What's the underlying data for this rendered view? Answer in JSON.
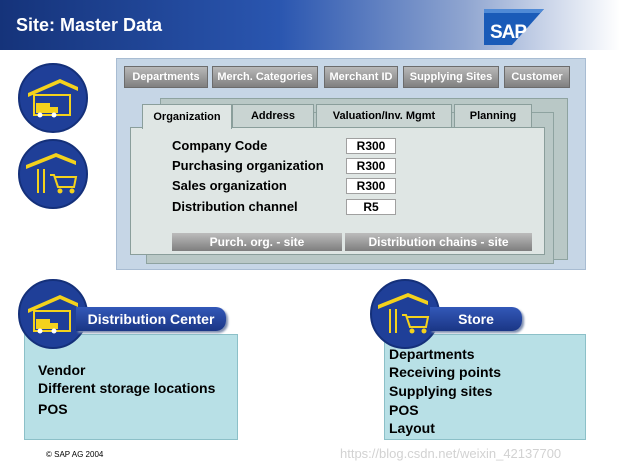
{
  "header": {
    "title": "Site: Master Data",
    "logo_text": "SAP"
  },
  "top_tabs": [
    "Departments",
    "Merch. Categories",
    "Merchant ID",
    "Supplying Sites",
    "Customer"
  ],
  "inner_tabs": [
    "Organization",
    "Address",
    "Valuation/Inv. Mgmt",
    "Planning"
  ],
  "fields": [
    {
      "label": "Company Code",
      "value": "R300"
    },
    {
      "label": "Purchasing organization",
      "value": "R300"
    },
    {
      "label": "Sales organization",
      "value": "R300"
    },
    {
      "label": "Distribution channel",
      "value": "R5"
    }
  ],
  "bottom_bars": [
    "Purch. org.   - site",
    "Distribution chains  -  site"
  ],
  "distribution_center": {
    "label": "Distribution Center",
    "items": [
      "Vendor",
      "Different storage locations",
      "POS"
    ]
  },
  "store": {
    "label": "Store",
    "items": [
      "Departments",
      "Receiving points",
      "Supplying sites",
      "POS",
      "Layout"
    ]
  },
  "footer": {
    "copyright": "©  SAP AG 2004",
    "watermark": "https://blog.csdn.net/weixin_42137700"
  },
  "icons": [
    "warehouse-truck-icon",
    "warehouse-cart-icon",
    "sap-logo-icon"
  ],
  "colors": {
    "title_bar": "#15337a",
    "panel": "#c6d6e6",
    "box": "#b8e0e6",
    "pill": "#1a3685"
  }
}
